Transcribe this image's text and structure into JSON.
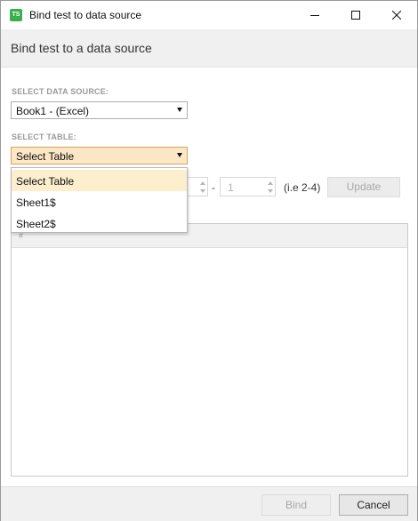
{
  "window": {
    "title": "Bind test to data source",
    "app_icon_text": "TS",
    "controls": [
      "minimize",
      "maximize",
      "close"
    ]
  },
  "header": {
    "title": "Bind test to a data source"
  },
  "data_source": {
    "label": "SELECT DATA SOURCE:",
    "selected": "Book1 - (Excel)"
  },
  "table": {
    "label": "SELECT TABLE:",
    "selected": "Select Table",
    "options": [
      "Select Table",
      "Sheet1$",
      "Sheet2$"
    ]
  },
  "range": {
    "to_value": "1",
    "separator": "-",
    "hint": "(i.e 2-4)",
    "update_label": "Update"
  },
  "grid": {
    "header_symbol": "#"
  },
  "footer": {
    "bind_label": "Bind",
    "cancel_label": "Cancel"
  },
  "colors": {
    "accent_select_bg": "#fbe6c6",
    "dropdown_selected_bg": "#fdeecd",
    "app_icon": "#3bb04a"
  }
}
